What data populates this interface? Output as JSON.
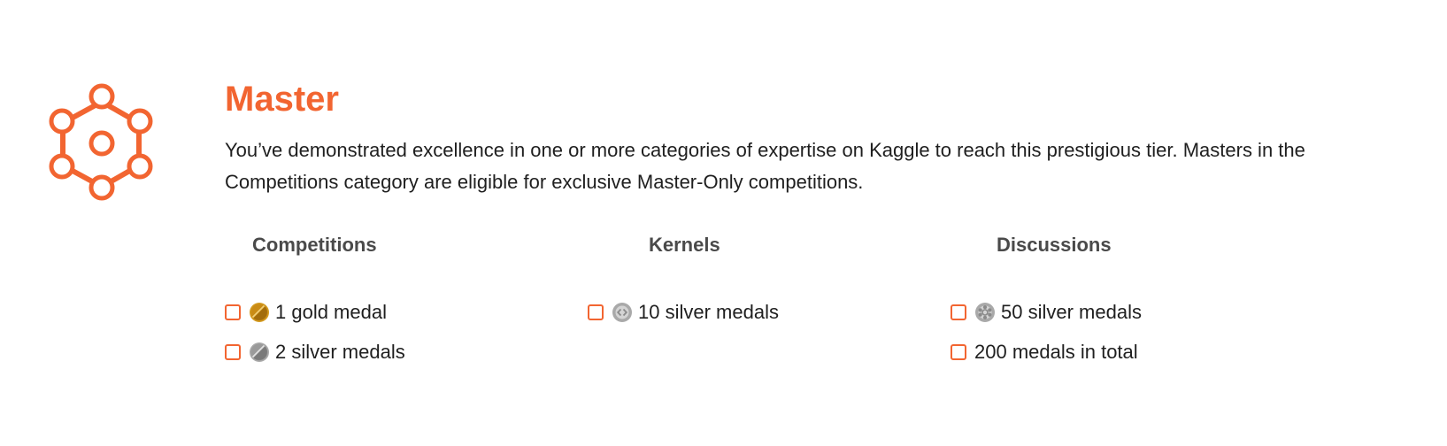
{
  "tier": {
    "title": "Master",
    "description": "You’ve demonstrated excellence in one or more categories of expertise on Kaggle to reach this prestigious tier. Masters in the Competitions category are eligible for exclusive Master-Only competitions.",
    "icon": "master-tier-icon",
    "accent_color": "#f26531"
  },
  "categories": {
    "competitions": {
      "heading": "Competitions",
      "requirements": [
        {
          "label": "1 gold medal",
          "checked": false,
          "icon": "gold-medal-icon"
        },
        {
          "label": "2 silver medals",
          "checked": false,
          "icon": "silver-medal-icon"
        }
      ]
    },
    "kernels": {
      "heading": "Kernels",
      "requirements": [
        {
          "label": "10 silver medals",
          "checked": false,
          "icon": "silver-kernel-medal-icon"
        }
      ]
    },
    "discussions": {
      "heading": "Discussions",
      "requirements": [
        {
          "label": "50 silver medals",
          "checked": false,
          "icon": "silver-discussion-medal-icon"
        },
        {
          "label": "200 medals in total",
          "checked": false
        }
      ]
    }
  }
}
